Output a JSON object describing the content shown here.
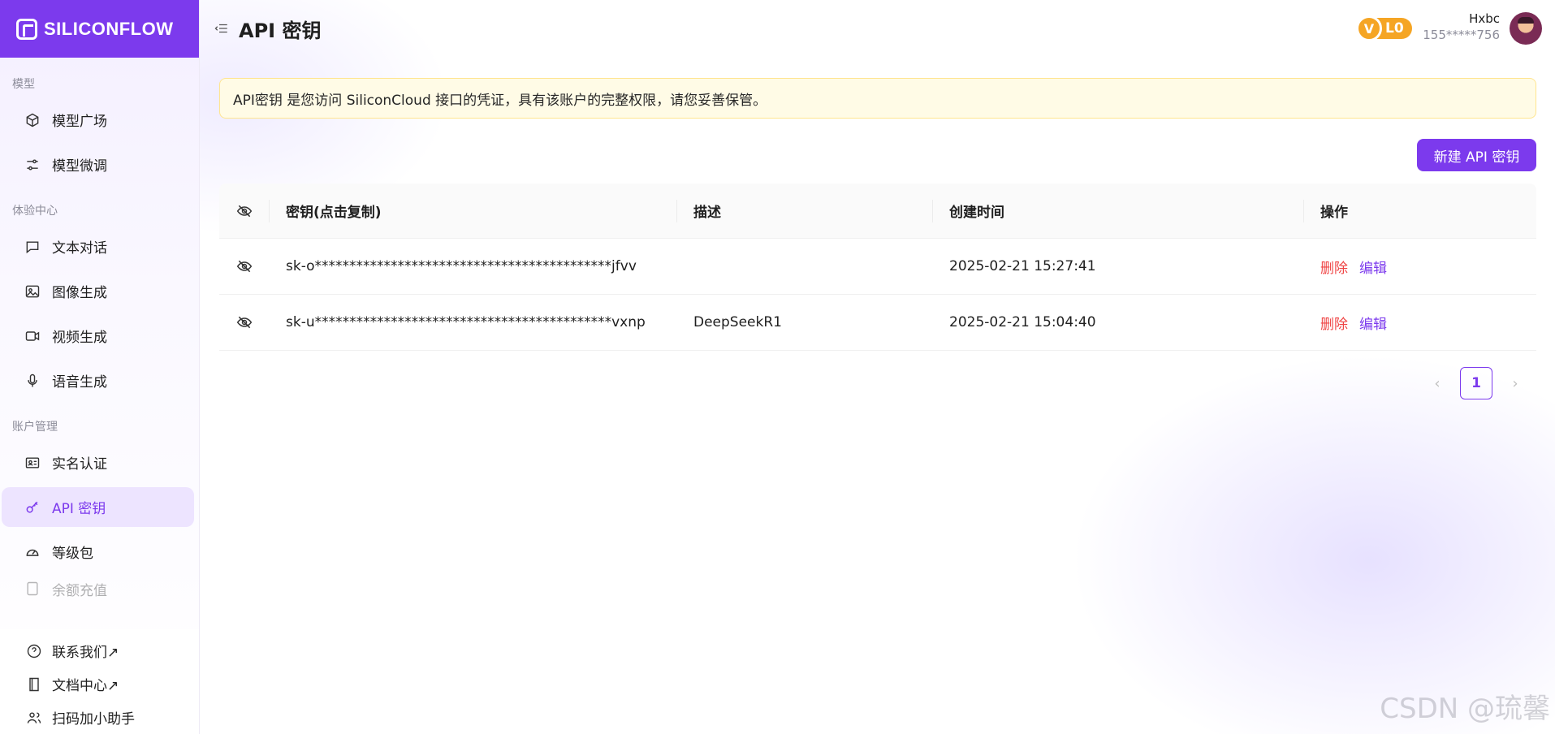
{
  "brand": {
    "name": "SILICONFLOW",
    "color": "#7c3aed"
  },
  "sidebar": {
    "sections": [
      {
        "label": "模型",
        "items": [
          {
            "label": "模型广场",
            "icon": "cube-icon"
          },
          {
            "label": "模型微调",
            "icon": "sliders-icon"
          }
        ]
      },
      {
        "label": "体验中心",
        "items": [
          {
            "label": "文本对话",
            "icon": "chat-icon"
          },
          {
            "label": "图像生成",
            "icon": "image-icon"
          },
          {
            "label": "视频生成",
            "icon": "video-icon"
          },
          {
            "label": "语音生成",
            "icon": "mic-icon"
          }
        ]
      },
      {
        "label": "账户管理",
        "items": [
          {
            "label": "实名认证",
            "icon": "id-card-icon"
          },
          {
            "label": "API 密钥",
            "icon": "key-icon",
            "active": true
          },
          {
            "label": "等级包",
            "icon": "gauge-icon"
          },
          {
            "label": "余额充值",
            "icon": "wallet-icon"
          }
        ]
      }
    ],
    "bottom_links": [
      {
        "label": "联系我们",
        "arrow": "↗",
        "icon": "help-icon"
      },
      {
        "label": "文档中心",
        "arrow": "↗",
        "icon": "book-icon"
      },
      {
        "label": "扫码加小助手",
        "icon": "users-icon"
      }
    ]
  },
  "header": {
    "title": "API 密钥",
    "level_badge": {
      "v": "V",
      "level": "L0",
      "color": "#f5a524"
    },
    "user": {
      "name": "Hxbc",
      "phone": "155*****756"
    }
  },
  "notice": "API密钥 是您访问 SiliconCloud 接口的凭证，具有该账户的完整权限，请您妥善保管。",
  "actions": {
    "new_key_label": "新建 API 密钥"
  },
  "table": {
    "columns": {
      "key": "密钥(点击复制)",
      "desc": "描述",
      "created": "创建时间",
      "ops": "操作"
    },
    "rows": [
      {
        "key": "sk-o*******************************************jfvv",
        "desc": "",
        "created": "2025-02-21 15:27:41",
        "delete": "删除",
        "edit": "编辑"
      },
      {
        "key": "sk-u*******************************************vxnp",
        "desc": "DeepSeekR1",
        "created": "2025-02-21 15:04:40",
        "delete": "删除",
        "edit": "编辑"
      }
    ]
  },
  "pagination": {
    "prev": "‹",
    "current": "1",
    "next": "›"
  },
  "watermark": "CSDN @琉馨"
}
